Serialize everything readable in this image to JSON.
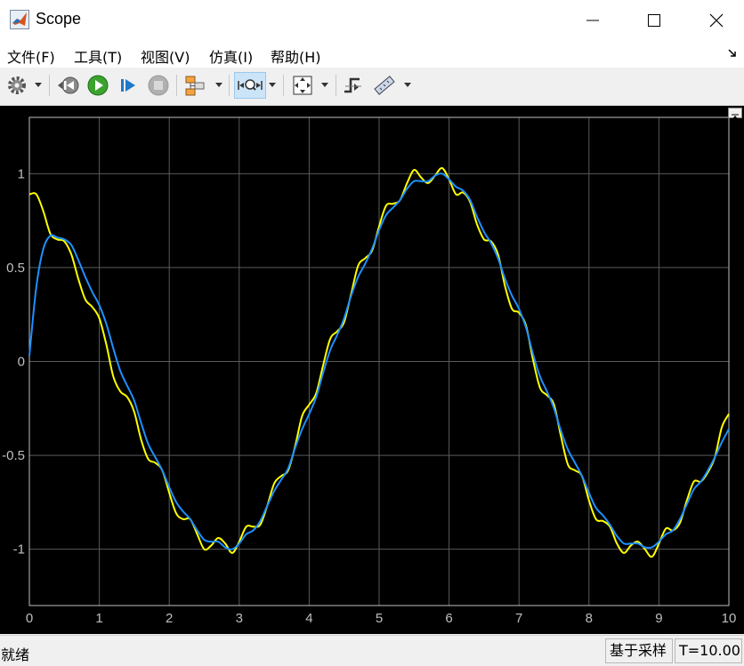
{
  "window": {
    "title": "Scope",
    "icon": "matlab-logo-icon",
    "controls": [
      "minimize-icon",
      "maximize-icon",
      "close-icon"
    ]
  },
  "menu": {
    "items": [
      "文件(F)",
      "工具(T)",
      "视图(V)",
      "仿真(I)",
      "帮助(H)"
    ]
  },
  "toolbar": {
    "buttons": [
      {
        "icon": "gear-icon",
        "dropdown": true
      },
      {
        "icon": "step-back-icon",
        "dropdown": false
      },
      {
        "icon": "run-icon",
        "dropdown": false
      },
      {
        "icon": "step-forward-icon",
        "dropdown": false
      },
      {
        "icon": "stop-icon",
        "dropdown": false
      },
      {
        "icon": "signal-highlight-icon",
        "dropdown": true
      },
      {
        "icon": "zoom-icon",
        "dropdown": true,
        "active": true
      },
      {
        "icon": "autoscale-icon",
        "dropdown": true
      },
      {
        "icon": "triggers-icon",
        "dropdown": false
      },
      {
        "icon": "measure-icon",
        "dropdown": true
      }
    ]
  },
  "status": {
    "left": "就绪",
    "mode": "基于采样",
    "time": "T=10.000"
  },
  "chart_data": {
    "type": "line",
    "title": "",
    "xlabel": "",
    "ylabel": "",
    "xlim": [
      0,
      10
    ],
    "ylim": [
      -1.3,
      1.3
    ],
    "xticks": [
      0,
      1,
      2,
      3,
      4,
      5,
      6,
      7,
      8,
      9,
      10
    ],
    "xtick_labels": [
      "0",
      "1",
      "2",
      "3",
      "4",
      "5",
      "6",
      "7",
      "8",
      "9",
      "10"
    ],
    "yticks": [
      -1,
      -0.5,
      0,
      0.5,
      1
    ],
    "ytick_labels": [
      "-1",
      "-0.5",
      "0",
      "0.5",
      "1"
    ],
    "grid": true,
    "background": "#000000",
    "grid_color": "#5a5a5a",
    "axis_color": "#bfbfbf",
    "series": [
      {
        "color": "#ffff00",
        "x": [
          0,
          0.1,
          0.2,
          0.3,
          0.4,
          0.5,
          0.6,
          0.7,
          0.8,
          0.9,
          1.0,
          1.1,
          1.2,
          1.3,
          1.4,
          1.5,
          1.6,
          1.7,
          1.8,
          1.9,
          2.0,
          2.1,
          2.2,
          2.3,
          2.4,
          2.5,
          2.6,
          2.7,
          2.8,
          2.9,
          3.0,
          3.1,
          3.2,
          3.3,
          3.4,
          3.5,
          3.6,
          3.7,
          3.8,
          3.9,
          4.0,
          4.1,
          4.2,
          4.3,
          4.4,
          4.5,
          4.6,
          4.7,
          4.8,
          4.9,
          5.0,
          5.1,
          5.2,
          5.3,
          5.4,
          5.5,
          5.6,
          5.7,
          5.8,
          5.9,
          6.0,
          6.1,
          6.2,
          6.3,
          6.4,
          6.5,
          6.6,
          6.7,
          6.8,
          6.9,
          7.0,
          7.1,
          7.2,
          7.3,
          7.4,
          7.5,
          7.6,
          7.7,
          7.8,
          7.9,
          8.0,
          8.1,
          8.2,
          8.3,
          8.4,
          8.5,
          8.6,
          8.7,
          8.8,
          8.9,
          9.0,
          9.1,
          9.2,
          9.3,
          9.4,
          9.5,
          9.6,
          9.7,
          9.8,
          9.9,
          10.0
        ],
        "y": [
          0.89,
          0.89,
          0.8,
          0.68,
          0.65,
          0.64,
          0.57,
          0.44,
          0.33,
          0.29,
          0.23,
          0.09,
          -0.08,
          -0.16,
          -0.19,
          -0.27,
          -0.42,
          -0.52,
          -0.54,
          -0.58,
          -0.7,
          -0.81,
          -0.84,
          -0.84,
          -0.92,
          -1.0,
          -0.98,
          -0.94,
          -0.97,
          -1.02,
          -0.96,
          -0.88,
          -0.88,
          -0.87,
          -0.77,
          -0.65,
          -0.61,
          -0.58,
          -0.45,
          -0.29,
          -0.23,
          -0.17,
          -0.02,
          0.12,
          0.16,
          0.21,
          0.36,
          0.51,
          0.55,
          0.59,
          0.72,
          0.83,
          0.84,
          0.86,
          0.95,
          1.02,
          0.98,
          0.95,
          0.99,
          1.03,
          0.97,
          0.89,
          0.9,
          0.85,
          0.73,
          0.65,
          0.64,
          0.57,
          0.4,
          0.28,
          0.26,
          0.19,
          0.01,
          -0.14,
          -0.18,
          -0.23,
          -0.4,
          -0.55,
          -0.58,
          -0.61,
          -0.74,
          -0.84,
          -0.85,
          -0.88,
          -0.97,
          -1.02,
          -0.98,
          -0.96,
          -1.0,
          -1.04,
          -0.97,
          -0.89,
          -0.9,
          -0.86,
          -0.74,
          -0.64,
          -0.64,
          -0.59,
          -0.51,
          -0.35,
          -0.28
        ]
      },
      {
        "color": "#1e90ff",
        "x": [
          0,
          0.1,
          0.2,
          0.3,
          0.4,
          0.5,
          0.6,
          0.7,
          0.8,
          0.9,
          1.0,
          1.1,
          1.2,
          1.3,
          1.4,
          1.5,
          1.6,
          1.7,
          1.8,
          1.9,
          2.0,
          2.1,
          2.2,
          2.3,
          2.4,
          2.5,
          2.6,
          2.7,
          2.8,
          2.9,
          3.0,
          3.1,
          3.2,
          3.3,
          3.4,
          3.5,
          3.6,
          3.7,
          3.8,
          3.9,
          4.0,
          4.1,
          4.2,
          4.3,
          4.4,
          4.5,
          4.6,
          4.7,
          4.8,
          4.9,
          5.0,
          5.1,
          5.2,
          5.3,
          5.4,
          5.5,
          5.6,
          5.7,
          5.8,
          5.9,
          6.0,
          6.1,
          6.2,
          6.3,
          6.4,
          6.5,
          6.6,
          6.7,
          6.8,
          6.9,
          7.0,
          7.1,
          7.2,
          7.3,
          7.4,
          7.5,
          7.6,
          7.7,
          7.8,
          7.9,
          8.0,
          8.1,
          8.2,
          8.3,
          8.4,
          8.5,
          8.6,
          8.7,
          8.8,
          8.9,
          9.0,
          9.1,
          9.2,
          9.3,
          9.4,
          9.5,
          9.6,
          9.7,
          9.8,
          9.9,
          10.0
        ],
        "y": [
          0.03,
          0.4,
          0.6,
          0.67,
          0.66,
          0.65,
          0.62,
          0.54,
          0.45,
          0.37,
          0.3,
          0.2,
          0.07,
          -0.05,
          -0.13,
          -0.21,
          -0.33,
          -0.44,
          -0.51,
          -0.58,
          -0.67,
          -0.75,
          -0.8,
          -0.84,
          -0.9,
          -0.95,
          -0.96,
          -0.96,
          -0.99,
          -1.0,
          -0.97,
          -0.92,
          -0.9,
          -0.85,
          -0.77,
          -0.69,
          -0.63,
          -0.57,
          -0.46,
          -0.36,
          -0.28,
          -0.19,
          -0.06,
          0.06,
          0.14,
          0.23,
          0.35,
          0.45,
          0.52,
          0.6,
          0.7,
          0.78,
          0.82,
          0.86,
          0.92,
          0.96,
          0.96,
          0.96,
          0.99,
          1.0,
          0.97,
          0.93,
          0.91,
          0.86,
          0.77,
          0.69,
          0.63,
          0.55,
          0.44,
          0.35,
          0.28,
          0.18,
          0.04,
          -0.08,
          -0.16,
          -0.25,
          -0.37,
          -0.47,
          -0.54,
          -0.61,
          -0.7,
          -0.78,
          -0.82,
          -0.87,
          -0.93,
          -0.97,
          -0.97,
          -0.97,
          -0.99,
          -0.99,
          -0.96,
          -0.92,
          -0.9,
          -0.84,
          -0.76,
          -0.68,
          -0.64,
          -0.58,
          -0.51,
          -0.43,
          -0.36
        ]
      }
    ]
  }
}
